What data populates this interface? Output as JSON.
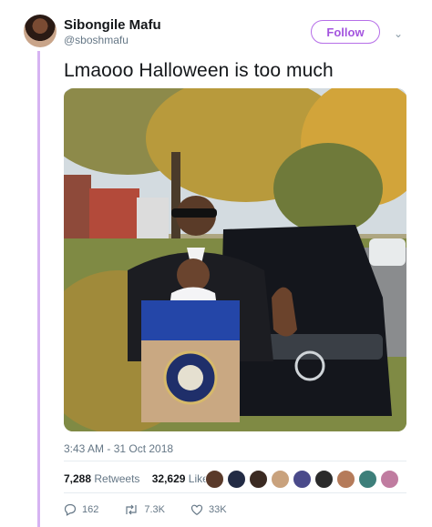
{
  "author": {
    "name": "Sibongile Mafu",
    "handle": "@sboshmafu",
    "avatar_icon": "profile-avatar"
  },
  "header": {
    "follow_label": "Follow",
    "menu_icon": "chevron-down-icon"
  },
  "tweet": {
    "text": "Lmaooo Halloween is too much",
    "timestamp": "3:43 AM - 31 Oct 2018",
    "media_icon": "halloween-costume-photo"
  },
  "stats": {
    "retweets_count": "7,288",
    "retweets_label": "Retweets",
    "likes_count": "32,629",
    "likes_label": "Likes",
    "likers_colors": [
      "#5a3a2a",
      "#222b44",
      "#3b2a22",
      "#c9a27d",
      "#4a4a8a",
      "#2b2b2b",
      "#b57b5a",
      "#3d7f7a",
      "#c07ca0"
    ]
  },
  "actions": {
    "reply_count": "162",
    "retweet_count": "7.3K",
    "like_count": "33K"
  },
  "colors": {
    "accent": "#a455df",
    "thread": "#d6b3f2",
    "muted": "#657786"
  }
}
